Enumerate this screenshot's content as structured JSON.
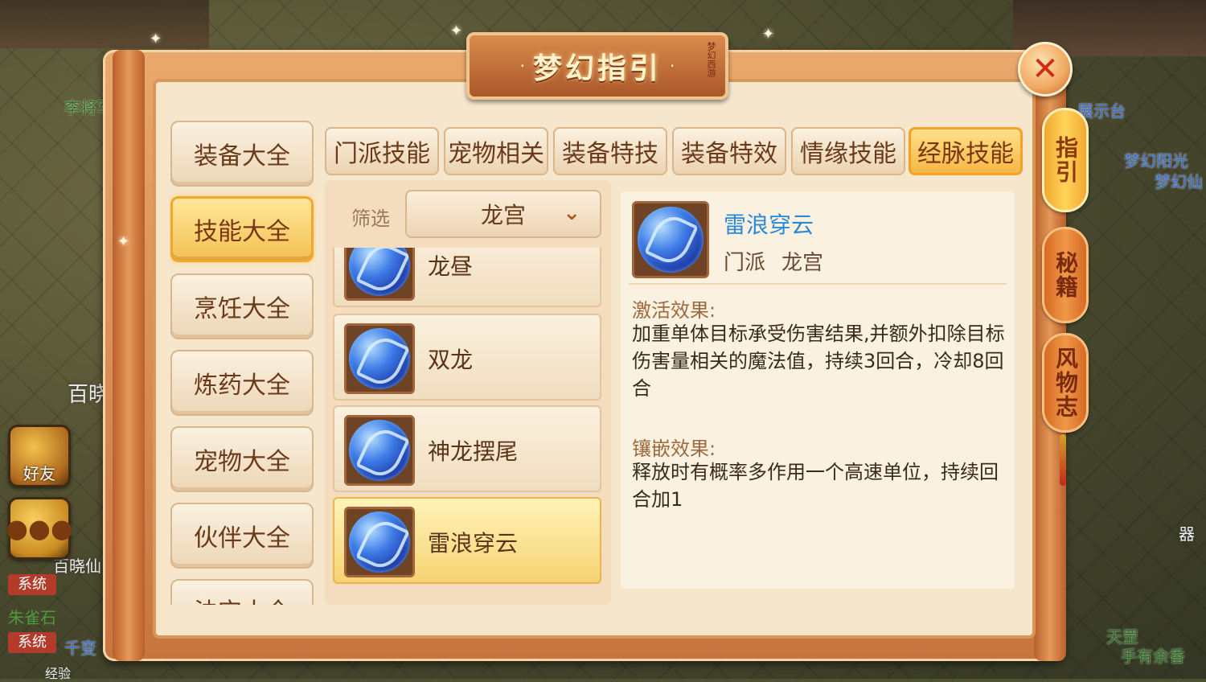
{
  "background": {
    "names": [
      "李将军",
      "百晓生",
      "梦幻阳光",
      "梦幻仙",
      "展示台",
      "百晓仙",
      "朱雀石",
      "千变",
      "器",
      "天罡",
      "手有余香",
      "经验"
    ],
    "buttons": {
      "friends": "好友"
    },
    "chat_tags": [
      "系统",
      "系统"
    ]
  },
  "dialog": {
    "title": "梦幻指引",
    "seal": "梦幻西游",
    "close_icon": "close-icon",
    "side_tabs": [
      "指引",
      "秘籍",
      "风物志"
    ],
    "active_side_tab": 0
  },
  "categories": [
    "装备大全",
    "技能大全",
    "烹饪大全",
    "炼药大全",
    "宠物大全",
    "伙伴大全",
    "法宝大全"
  ],
  "active_category": 1,
  "tabs": [
    "门派技能",
    "宠物相关",
    "装备特技",
    "装备特效",
    "情缘技能",
    "经脉技能"
  ],
  "active_tab": 5,
  "filter": {
    "label": "筛选",
    "selected": "龙宫"
  },
  "skills": [
    {
      "name": "龙昼"
    },
    {
      "name": "双龙"
    },
    {
      "name": "神龙摆尾"
    },
    {
      "name": "雷浪穿云",
      "selected": true
    }
  ],
  "detail": {
    "name": "雷浪穿云",
    "sect_label": "门派",
    "sect_value": "龙宫",
    "activate_title": "激活效果:",
    "activate_text": "加重单体目标承受伤害结果,并额外扣除目标伤害量相关的魔法值，持续3回合，冷却8回合",
    "inlay_title": "镶嵌效果:",
    "inlay_text": "释放时有概率多作用一个高速单位，持续回合加1"
  },
  "colors": {
    "accent_gold": "#f4c052",
    "detail_name": "#2a8ad8",
    "close_x": "#d42a18"
  }
}
